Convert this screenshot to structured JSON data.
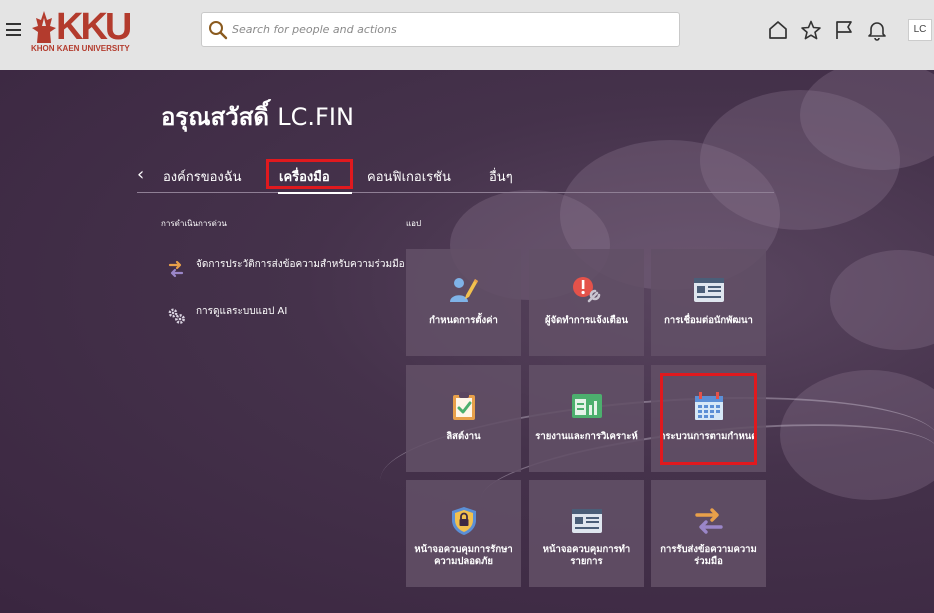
{
  "header": {
    "logo": {
      "wordmark": "KKU",
      "subtitle": "KHON KAEN UNIVERSITY"
    },
    "search": {
      "placeholder": "Search for people and actions",
      "value": ""
    },
    "icons": [
      "home-icon",
      "star-icon",
      "flag-icon",
      "bell-icon"
    ],
    "avatar": "LC"
  },
  "greeting": {
    "hello": "อรุณสวัสดิ์",
    "name": "LC.FIN"
  },
  "tabs": [
    {
      "label": "องค์กรของฉัน"
    },
    {
      "label": "เครื่องมือ",
      "active": true
    },
    {
      "label": "คอนฟิเกอเรชัน"
    },
    {
      "label": "อื่นๆ"
    }
  ],
  "quick_actions": {
    "heading": "การดำเนินการด่วน",
    "items": [
      {
        "label": "จัดการประวัติการส่งข้อความสำหรับความร่วมมือ",
        "icon": "transfer-arrows-icon"
      },
      {
        "label": "การดูแลระบบแอป AI",
        "icon": "gears-icon"
      }
    ]
  },
  "apps": {
    "heading": "แอป",
    "tiles": [
      {
        "label": "กำหนดการตั้งค่า",
        "icon": "user-settings-icon"
      },
      {
        "label": "ผู้จัดทำการแจ้งเตือน",
        "icon": "alert-wrench-icon"
      },
      {
        "label": "การเชื่อมต่อนักพัฒนา",
        "icon": "developer-screen-icon"
      },
      {
        "label": "ลิสต์งาน",
        "icon": "clipboard-check-icon"
      },
      {
        "label": "รายงานและการวิเคราะห์",
        "icon": "report-chart-icon"
      },
      {
        "label": "กระบวนการตามกำหนด",
        "icon": "calendar-icon"
      },
      {
        "label": "หน้าจอควบคุมการรักษาความปลอดภัย",
        "icon": "security-shield-icon"
      },
      {
        "label": "หน้าจอควบคุมการทำรายการ",
        "icon": "transaction-screen-icon"
      },
      {
        "label": "การรับส่งข้อความความร่วมมือ",
        "icon": "collaboration-arrows-icon"
      }
    ]
  },
  "colors": {
    "header_bg": "#e4e4e4",
    "page_bg": "#3e2a43",
    "tile_bg": "#625067",
    "highlight": "#e0191e",
    "logo": "#b33b2d"
  }
}
